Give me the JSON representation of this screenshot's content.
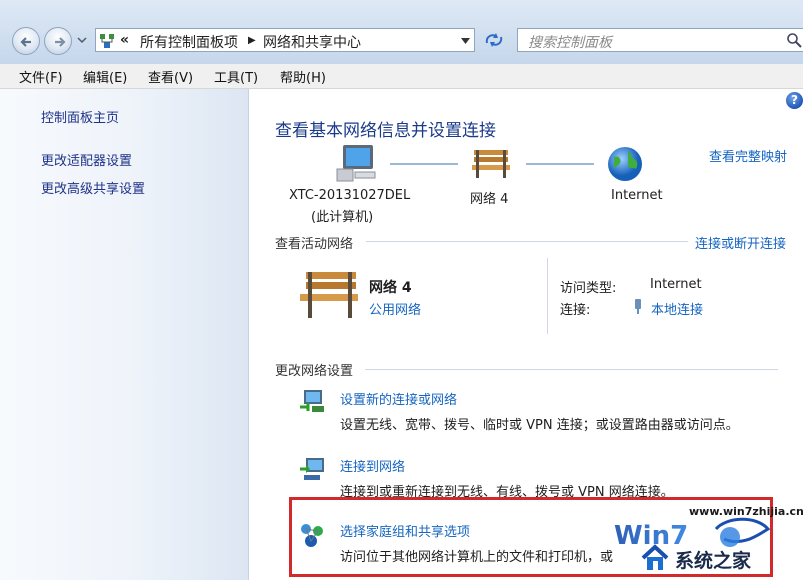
{
  "address": {
    "overflow": "«",
    "crumbs": [
      "所有控制面板项",
      "网络和共享中心"
    ],
    "search_placeholder": "搜索控制面板"
  },
  "menu": [
    "文件(F)",
    "编辑(E)",
    "查看(V)",
    "工具(T)",
    "帮助(H)"
  ],
  "sidebar": {
    "items": [
      "控制面板主页",
      "更改适配器设置",
      "更改高级共享设置"
    ]
  },
  "main": {
    "title": "查看基本网络信息并设置连接",
    "view_full_map": "查看完整映射",
    "map": {
      "computer_line1": "XTC-20131027DEL",
      "computer_line2": "(此计算机)",
      "network": "网络 4",
      "internet": "Internet"
    },
    "active_section": "查看活动网络",
    "connect_disconnect": "连接或断开连接",
    "active": {
      "name": "网络 4",
      "type": "公用网络",
      "access_label": "访问类型:",
      "access_value": "Internet",
      "conn_label": "连接:",
      "conn_value": "本地连接"
    },
    "change_section": "更改网络设置",
    "tasks": [
      {
        "title": "设置新的连接或网络",
        "desc": "设置无线、宽带、拨号、临时或 VPN 连接；或设置路由器或访问点。"
      },
      {
        "title": "连接到网络",
        "desc": "连接到或重新连接到无线、有线、拨号或 VPN 网络连接。"
      },
      {
        "title": "选择家庭组和共享选项",
        "desc": "访问位于其他网络计算机上的文件和打印机，或"
      }
    ]
  },
  "watermark": {
    "url": "www.win7zhijia.cn",
    "brand": "系统之家"
  },
  "colors": {
    "link": "#1565c0",
    "highlight": "#d22a2a"
  }
}
